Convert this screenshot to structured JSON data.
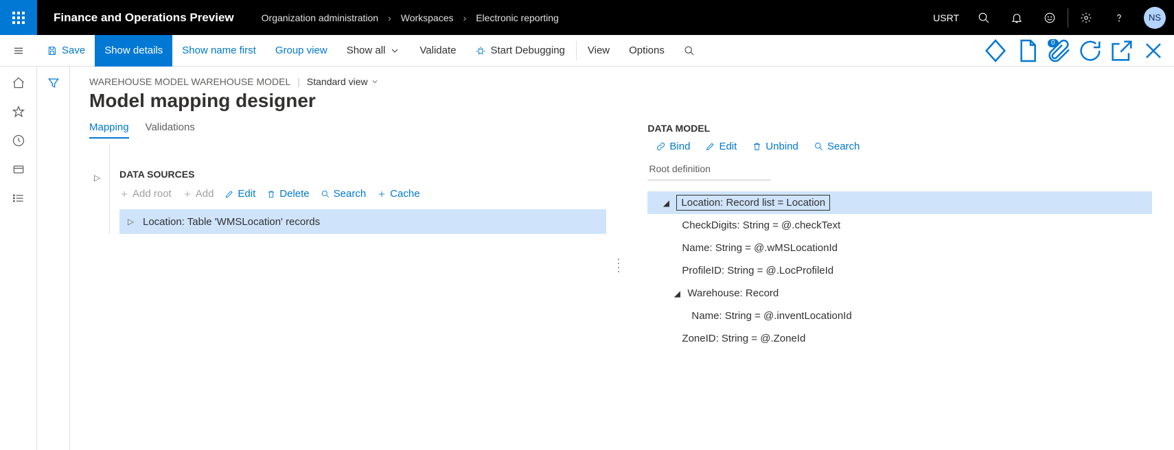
{
  "header": {
    "app_title": "Finance and Operations Preview",
    "breadcrumbs": [
      "Organization administration",
      "Workspaces",
      "Electronic reporting"
    ],
    "user_code": "USRT",
    "avatar_initials": "NS"
  },
  "commands": {
    "save": "Save",
    "show_details": "Show details",
    "show_name_first": "Show name first",
    "group_view": "Group view",
    "show_all": "Show all",
    "validate": "Validate",
    "start_debugging": "Start Debugging",
    "view": "View",
    "options": "Options",
    "badge_count": "0"
  },
  "page": {
    "context": "WAREHOUSE MODEL WAREHOUSE MODEL",
    "view_name": "Standard view",
    "title": "Model mapping designer",
    "tabs": {
      "mapping": "Mapping",
      "validations": "Validations"
    }
  },
  "data_sources": {
    "section": "DATA SOURCES",
    "tools": {
      "add_root": "Add root",
      "add": "Add",
      "edit": "Edit",
      "delete": "Delete",
      "search": "Search",
      "cache": "Cache"
    },
    "row1": "Location: Table 'WMSLocation' records"
  },
  "data_model": {
    "section": "DATA MODEL",
    "tools": {
      "bind": "Bind",
      "edit": "Edit",
      "unbind": "Unbind",
      "search": "Search"
    },
    "root_label": "Root definition",
    "rows": {
      "location": "Location: Record list = Location",
      "check_digits": "CheckDigits: String = @.checkText",
      "name": "Name: String = @.wMSLocationId",
      "profile": "ProfileID: String = @.LocProfileId",
      "warehouse": "Warehouse: Record",
      "wh_name": "Name: String = @.inventLocationId",
      "zone": "ZoneID: String = @.ZoneId"
    }
  }
}
